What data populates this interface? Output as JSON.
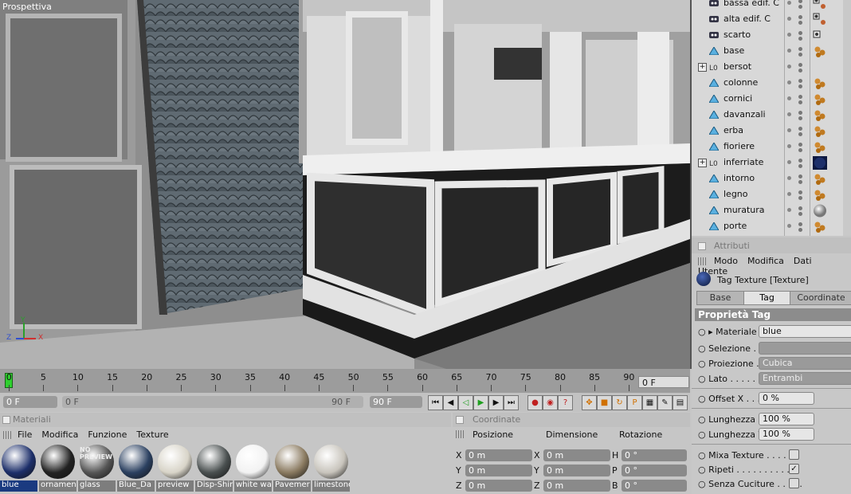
{
  "viewport": {
    "label": "Prospettiva"
  },
  "objects": [
    {
      "label": "bassa edif. C",
      "type": "null",
      "tag": "multi"
    },
    {
      "label": "alta edif. C",
      "type": "null",
      "tag": "multi"
    },
    {
      "label": "scarto",
      "type": "null",
      "tag": "grid"
    },
    {
      "label": "base",
      "type": "poly",
      "tag": "balls"
    },
    {
      "label": "bersot",
      "type": "group",
      "tag": "none",
      "expand": "+"
    },
    {
      "label": "colonne",
      "type": "poly",
      "tag": "balls"
    },
    {
      "label": "cornici",
      "type": "poly",
      "tag": "balls"
    },
    {
      "label": "davanzali",
      "type": "poly",
      "tag": "balls"
    },
    {
      "label": "erba",
      "type": "poly",
      "tag": "balls"
    },
    {
      "label": "fioriere",
      "type": "poly",
      "tag": "balls"
    },
    {
      "label": "inferriate",
      "type": "group",
      "tag": "blue",
      "expand": "+"
    },
    {
      "label": "intorno",
      "type": "poly",
      "tag": "balls"
    },
    {
      "label": "legno",
      "type": "poly",
      "tag": "balls"
    },
    {
      "label": "muratura",
      "type": "poly",
      "tag": "sphere"
    },
    {
      "label": "porte",
      "type": "poly",
      "tag": "balls"
    }
  ],
  "attributes": {
    "header": "Attributi",
    "menu": [
      "Modo",
      "Modifica",
      "Dati Utente"
    ],
    "title": "Tag Texture [Texture]",
    "tabs": [
      "Base",
      "Tag",
      "Coordinate"
    ],
    "active_tab": "Tag",
    "section": "Proprietà Tag",
    "materiale_label": "Materiale",
    "materiale_value": "blue",
    "selezione_label": "Selezione . . .",
    "selezione_value": "",
    "proiezione_label": "Proiezione . . .",
    "proiezione_value": "Cubica",
    "lato_label": "Lato . . . . . . . .",
    "lato_value": "Entrambi",
    "offsetx_label": "Offset X . . .",
    "offsetx_value": "0 %",
    "lunghx_label": "Lunghezza X",
    "lunghx_value": "100 %",
    "lunghy_label": "Lunghezza Y",
    "lunghy_value": "100 %",
    "mixa_label": "Mixa Texture . . . . . .",
    "ripeti_label": "Ripeti . . . . . . . . . . .",
    "senza_label": "Senza Cuciture . . . . .",
    "mixa_checked": false,
    "ripeti_checked": true,
    "senza_checked": false
  },
  "timeline": {
    "ticks": [
      "0",
      "5",
      "10",
      "15",
      "20",
      "25",
      "30",
      "35",
      "40",
      "45",
      "50",
      "55",
      "60",
      "65",
      "70",
      "75",
      "80",
      "85",
      "90"
    ],
    "current_frame": "0 F"
  },
  "transport": {
    "start": "0 F",
    "range_start": "0 F",
    "range_end": "90 F",
    "end": "90 F"
  },
  "materials": {
    "header": "Materiali",
    "menu": [
      "File",
      "Modifica",
      "Funzione",
      "Texture"
    ],
    "items": [
      {
        "name": "blue",
        "color": "#1d2f6a"
      },
      {
        "name": "ornamen",
        "color": "#222222"
      },
      {
        "name": "glass",
        "color": "#555555"
      },
      {
        "name": "Blue_Da",
        "color": "#2b4060"
      },
      {
        "name": "preview",
        "color": "#d8d4c8"
      },
      {
        "name": "Disp-Shir",
        "color": "#4a5050"
      },
      {
        "name": "white wa",
        "color": "#f2f2f2"
      },
      {
        "name": "Pavemer",
        "color": "#8a7a60"
      },
      {
        "name": "limestone",
        "color": "#c8c4bc"
      }
    ],
    "glass_overlay": "NO PREVIEW"
  },
  "coordinates": {
    "header": "Coordinate",
    "col_labels": [
      "Posizione",
      "Dimensione",
      "Rotazione"
    ],
    "rows": [
      {
        "a1": "X",
        "v1": "0 m",
        "a2": "X",
        "v2": "0 m",
        "a3": "H",
        "v3": "0 °"
      },
      {
        "a1": "Y",
        "v1": "0 m",
        "a2": "Y",
        "v2": "0 m",
        "a3": "P",
        "v3": "0 °"
      },
      {
        "a1": "Z",
        "v1": "0 m",
        "a2": "Z",
        "v2": "0 m",
        "a3": "B",
        "v3": "0 °"
      }
    ]
  }
}
